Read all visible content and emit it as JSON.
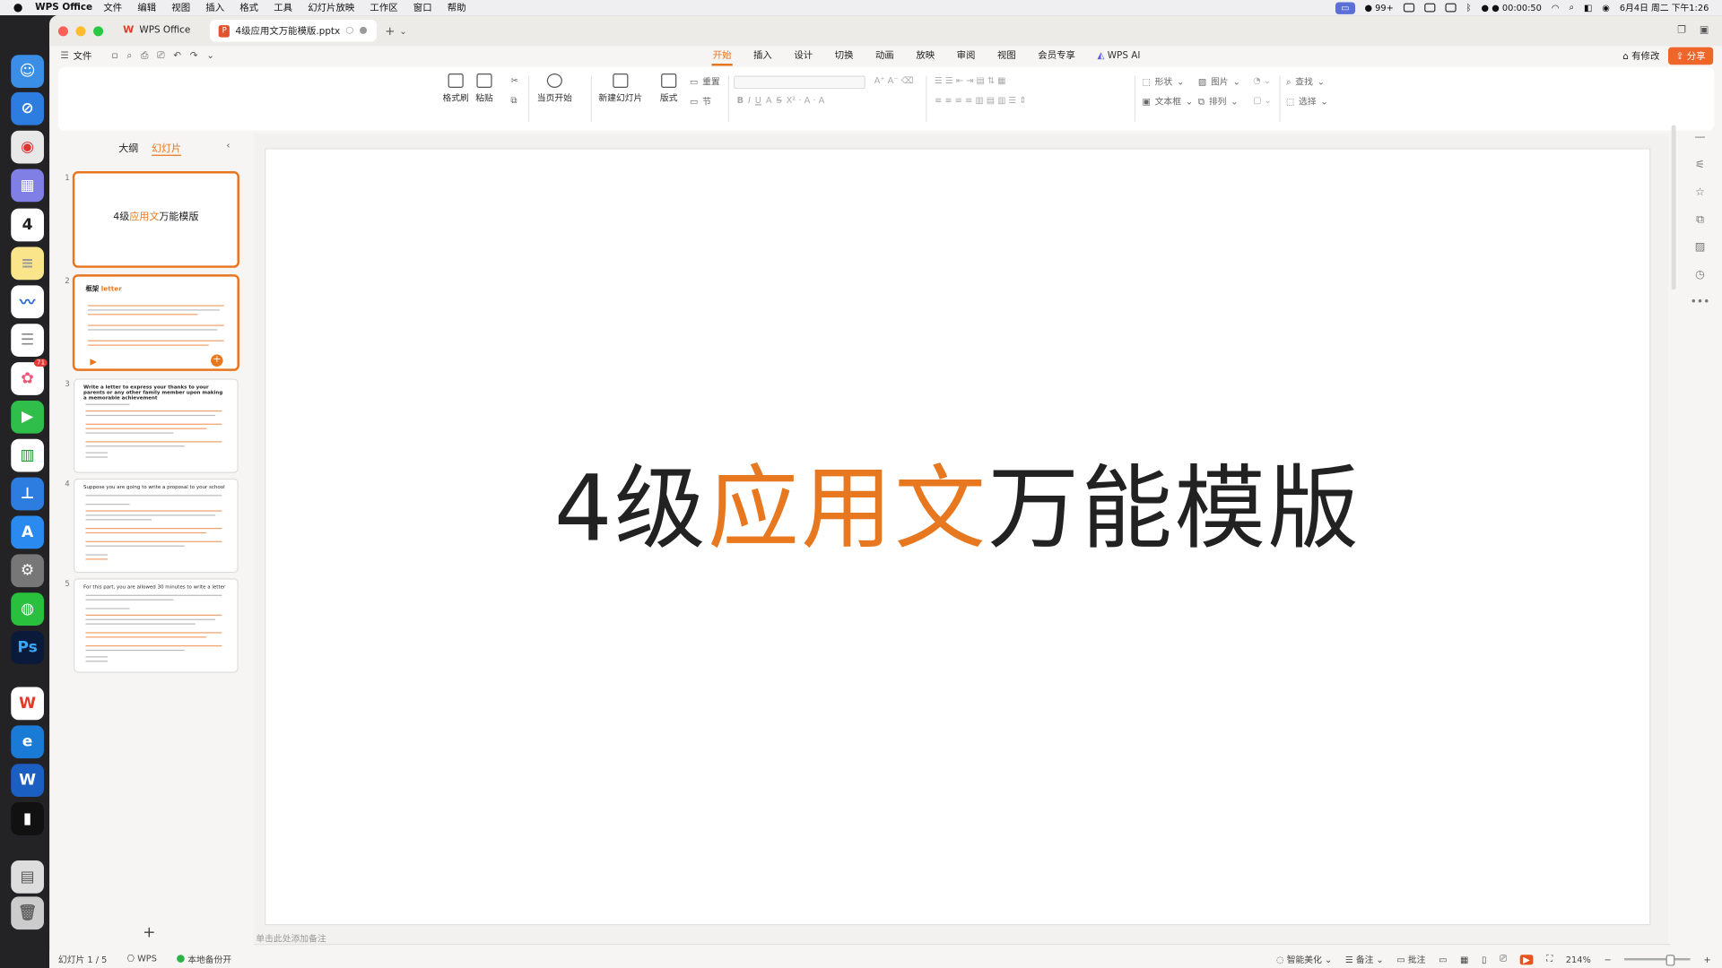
{
  "menubar": {
    "app": "WPS Office",
    "items": [
      "文件",
      "编辑",
      "视图",
      "插入",
      "格式",
      "工具",
      "幻灯片放映",
      "工作区",
      "窗口",
      "帮助"
    ],
    "status": {
      "wechat": "99+",
      "timer": "00:00:50",
      "datetime": "6月4日 周二 下午1:26"
    }
  },
  "dock": {
    "calendar_day": "4",
    "photos_badge": "71"
  },
  "tabs": {
    "home": "WPS Office",
    "file": "4级应用文万能模版.pptx"
  },
  "menurow": {
    "file": "文件",
    "ribbon_tabs": [
      "开始",
      "插入",
      "设计",
      "切换",
      "动画",
      "放映",
      "审阅",
      "视图",
      "会员专享",
      "WPS AI"
    ],
    "active_tab": "开始",
    "comment": "有修改",
    "share": "分享"
  },
  "ribbon": {
    "format_painter": "格式刷",
    "paste": "粘贴",
    "play_from_current": "当页开始",
    "new_slide": "新建幻灯片",
    "layout": "版式",
    "reset": "重置",
    "section": "节",
    "shape": "形状",
    "picture": "图片",
    "find": "查找",
    "textbox": "文本框",
    "arrange": "排列",
    "select": "选择"
  },
  "sidebar": {
    "tab_outline": "大纲",
    "tab_slides": "幻灯片",
    "slides": [
      {
        "num": "1",
        "title_pre": "4级",
        "title_hi": "应用文",
        "title_post": "万能模版"
      },
      {
        "num": "2",
        "title_pre": "框架 ",
        "title_hi": "letter"
      },
      {
        "num": "3",
        "title_pre": "Write a letter to express your thanks to your parents or any other family member upon making a memorable achievement"
      },
      {
        "num": "4",
        "title_pre": "Suppose you are going to write a proposal to your school"
      },
      {
        "num": "5",
        "title_pre": "For this part, you are allowed 30 minutes to write a letter"
      }
    ]
  },
  "slide": {
    "title_pre": "4级",
    "title_hi": "应用文",
    "title_post": "万能模版"
  },
  "notes_placeholder": "单击此处添加备注",
  "status": {
    "slide_info": "幻灯片 1 / 5",
    "theme": "WPS",
    "backup": "本地备份开",
    "beautify": "智能美化",
    "notes": "备注",
    "comment": "批注",
    "zoom": "214%"
  }
}
